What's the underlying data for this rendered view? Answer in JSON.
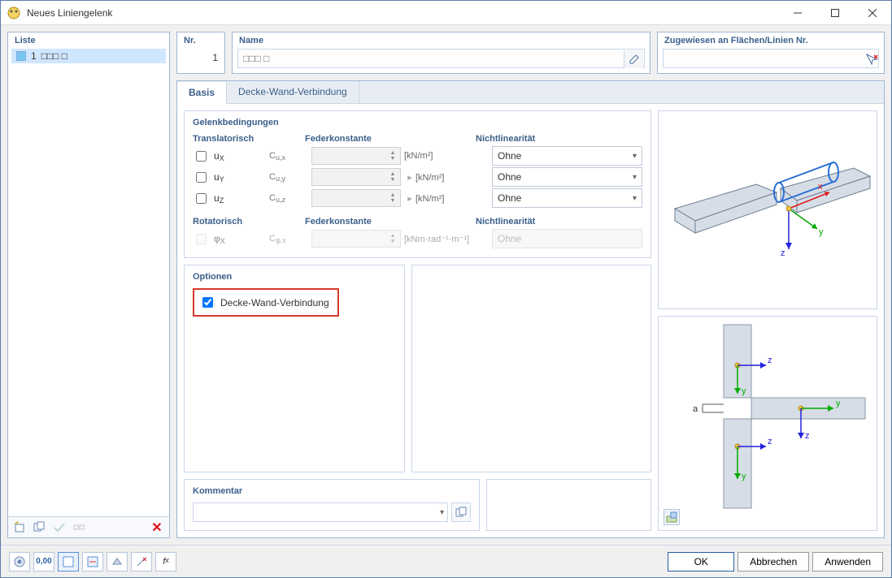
{
  "window": {
    "title": "Neues Liniengelenk"
  },
  "list": {
    "title": "Liste",
    "items": [
      {
        "num": "1",
        "label": "□□□ □"
      }
    ]
  },
  "nr": {
    "title": "Nr.",
    "value": "1"
  },
  "name": {
    "title": "Name",
    "value": "□□□ □"
  },
  "assign": {
    "title": "Zugewiesen an Flächen/Linien Nr."
  },
  "tabs": {
    "basis": "Basis",
    "wand": "Decke-Wand-Verbindung"
  },
  "gelenk": {
    "title": "Gelenkbedingungen",
    "trans_label": "Translatorisch",
    "feder_label": "Federkonstante",
    "nl_label": "Nichtlinearität",
    "rot_label": "Rotatorisch",
    "rows_trans": [
      {
        "dof": "uₓ",
        "const": "Cu,x",
        "unit": "[kN/m²]",
        "nl": "Ohne"
      },
      {
        "dof": "uᵧ",
        "const": "Cu,y",
        "unit": "[kN/m²]",
        "nl": "Ohne"
      },
      {
        "dof": "u₂",
        "dof_plain": "uZ",
        "const": "Cu,z",
        "unit": "[kN/m²]",
        "nl": "Ohne"
      }
    ],
    "rows_rot": [
      {
        "dof": "φₓ",
        "const": "Cφ,x",
        "unit": "[kNm·rad⁻¹·m⁻¹]",
        "nl": "Ohne"
      }
    ]
  },
  "options": {
    "title": "Optionen",
    "decke_wand": "Decke-Wand-Verbindung"
  },
  "kommentar": {
    "title": "Kommentar"
  },
  "axes": {
    "x": "x",
    "y": "y",
    "z": "z",
    "a": "a"
  },
  "buttons": {
    "ok": "OK",
    "cancel": "Abbrechen",
    "apply": "Anwenden"
  }
}
